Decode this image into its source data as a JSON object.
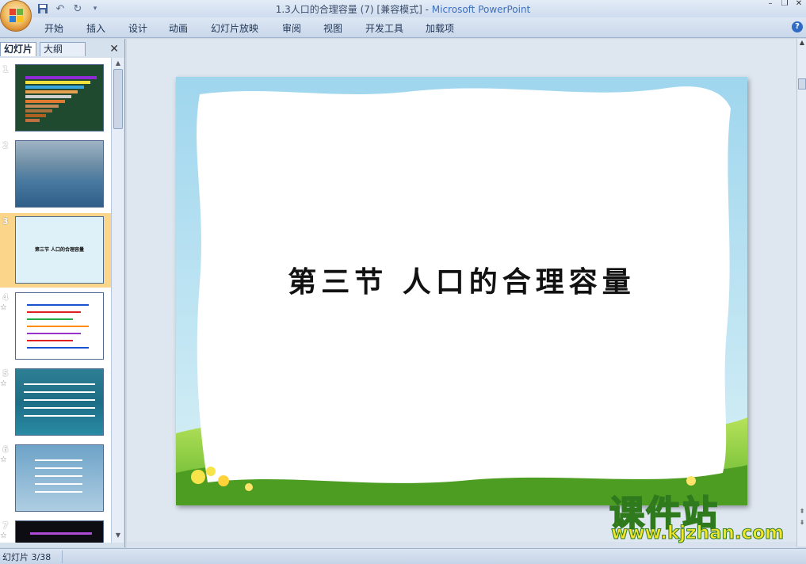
{
  "window": {
    "title": "1.3人口的合理容量 (7) [兼容模式] - ",
    "app_name": "Microsoft PowerPoint"
  },
  "ribbon": {
    "tabs": [
      "开始",
      "插入",
      "设计",
      "动画",
      "幻灯片放映",
      "审阅",
      "视图",
      "开发工具",
      "加载项"
    ]
  },
  "left_pane": {
    "tab_slides": "幻灯片",
    "tab_outline": "大纲",
    "slides": [
      {
        "number": "1",
        "star": ""
      },
      {
        "number": "2",
        "star": ""
      },
      {
        "number": "3",
        "star": "",
        "selected": true,
        "caption": "第三节  人口的合理容量"
      },
      {
        "number": "4",
        "star": "☆"
      },
      {
        "number": "5",
        "star": "☆"
      },
      {
        "number": "6",
        "star": "☆"
      },
      {
        "number": "7",
        "star": "☆"
      }
    ]
  },
  "slide": {
    "title": "第三节  人口的合理容量"
  },
  "status": {
    "slide_counter": "幻灯片 3/38"
  },
  "watermark": {
    "text": "课件站",
    "url": "www.kjzhan.com"
  },
  "colors": {
    "accent": "#3b6fbf",
    "selected_thumb": "#fbd68a",
    "watermark_fill": "#f2e52a",
    "watermark_stroke": "#2f7a1c"
  }
}
